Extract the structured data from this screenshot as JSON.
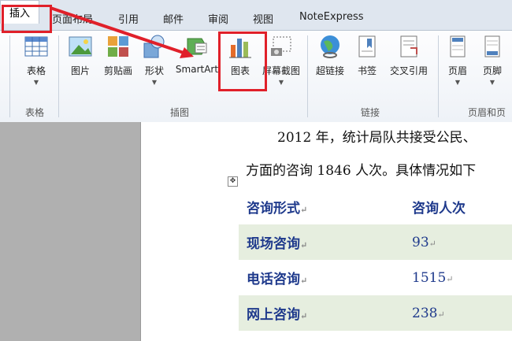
{
  "tabs": [
    "插入",
    "页面布局",
    "引用",
    "邮件",
    "审阅",
    "视图",
    "NoteExpress"
  ],
  "groups": {
    "table": "表格",
    "illustrations": "插图",
    "links": "链接",
    "header_footer": "页眉和页"
  },
  "buttons": {
    "table": "表格",
    "picture": "图片",
    "clipart": "剪贴画",
    "shapes": "形状",
    "smartart": "SmartArt",
    "chart": "图表",
    "screenshot": "屏幕截图",
    "hyperlink": "超链接",
    "bookmark": "书签",
    "crossref": "交叉引用",
    "header": "页眉",
    "footer": "页脚"
  },
  "document": {
    "line1": "2012 年，统计局队共接受公民、",
    "line2": "方面的咨询 1846 人次。具体情况如下",
    "table_header": [
      "咨询形式",
      "咨询人次"
    ],
    "rows": [
      {
        "type": "现场咨询",
        "count": "93"
      },
      {
        "type": "电话咨询",
        "count": "1515"
      },
      {
        "type": "网上咨询",
        "count": "238"
      }
    ]
  },
  "colors": {
    "highlight": "#e0202a",
    "table_text": "#1f3a8c",
    "shade": "#e6eedf"
  }
}
